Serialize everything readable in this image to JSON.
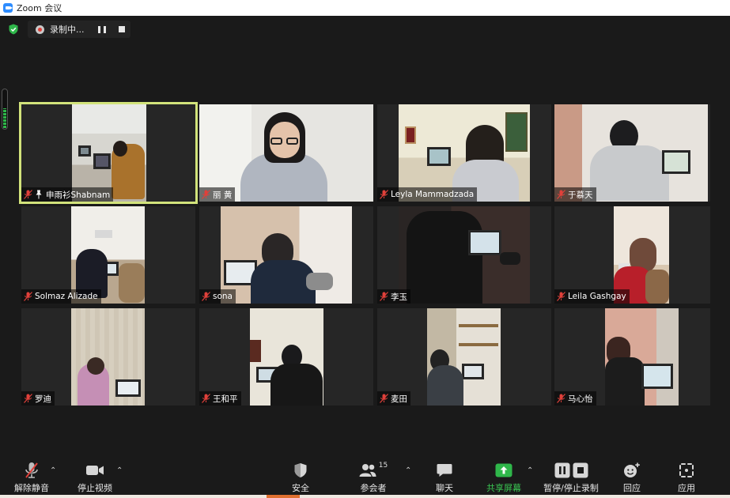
{
  "window": {
    "title": "Zoom 会议"
  },
  "recording": {
    "status": "录制中..."
  },
  "colors": {
    "active_border": "#d2e37b",
    "accent_green": "#3ac652",
    "mic_off_red": "#e0403a"
  },
  "participants": [
    {
      "name": "申雨衫Shabnam",
      "pinned": true,
      "active": true,
      "muted": true
    },
    {
      "name": "丽 黄",
      "muted": true
    },
    {
      "name": "Leyla Mammadzada",
      "muted": true
    },
    {
      "name": "于慕天",
      "muted": true
    },
    {
      "name": "Solmaz Alizade",
      "muted": true
    },
    {
      "name": "sona",
      "muted": true
    },
    {
      "name": "李玉",
      "muted": true
    },
    {
      "name": "Leila Gashgay",
      "muted": true
    },
    {
      "name": "罗迪",
      "muted": true
    },
    {
      "name": "王和平",
      "muted": true
    },
    {
      "name": "麦田",
      "muted": true
    },
    {
      "name": "马心怡",
      "muted": true
    }
  ],
  "toolbar": {
    "unmute": "解除静音",
    "stop_video": "停止视频",
    "security": "安全",
    "participants": "参会者",
    "participants_count": "15",
    "chat": "聊天",
    "share_screen": "共享屏幕",
    "pause_stop_recording": "暂停/停止录制",
    "reactions": "回应",
    "apps": "应用"
  }
}
